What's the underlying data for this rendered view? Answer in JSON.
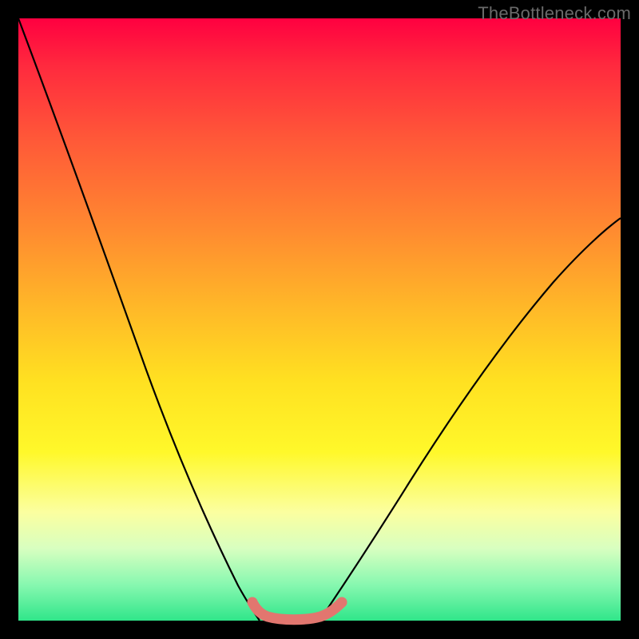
{
  "watermark": "TheBottleneck.com",
  "chart_data": {
    "type": "line",
    "title": "",
    "xlabel": "",
    "ylabel": "",
    "xlim": [
      0,
      1
    ],
    "ylim": [
      0,
      1
    ],
    "grid": false,
    "legend": false,
    "series": [
      {
        "name": "left-curve",
        "x": [
          0.0,
          0.06,
          0.12,
          0.18,
          0.24,
          0.3,
          0.35,
          0.39,
          0.4
        ],
        "y": [
          1.0,
          0.78,
          0.58,
          0.41,
          0.27,
          0.16,
          0.085,
          0.03,
          0.0
        ]
      },
      {
        "name": "right-curve",
        "x": [
          0.5,
          0.56,
          0.62,
          0.68,
          0.74,
          0.8,
          0.86,
          0.92,
          0.98,
          1.0
        ],
        "y": [
          0.0,
          0.055,
          0.13,
          0.215,
          0.305,
          0.4,
          0.49,
          0.575,
          0.65,
          0.67
        ]
      },
      {
        "name": "bottom-pink-band",
        "x": [
          0.39,
          0.41,
          0.44,
          0.47,
          0.5,
          0.53,
          0.54
        ],
        "y": [
          0.03,
          0.012,
          0.005,
          0.004,
          0.005,
          0.012,
          0.03
        ]
      }
    ],
    "annotations": {
      "bottom_band_color": "#e2766f",
      "curve_color": "#000000",
      "gradient_stops": [
        {
          "pos": 0.0,
          "color": "#ff0040"
        },
        {
          "pos": 0.35,
          "color": "#ff8a30"
        },
        {
          "pos": 0.6,
          "color": "#ffe021"
        },
        {
          "pos": 0.82,
          "color": "#fbffa0"
        },
        {
          "pos": 1.0,
          "color": "#30e68a"
        }
      ]
    }
  }
}
